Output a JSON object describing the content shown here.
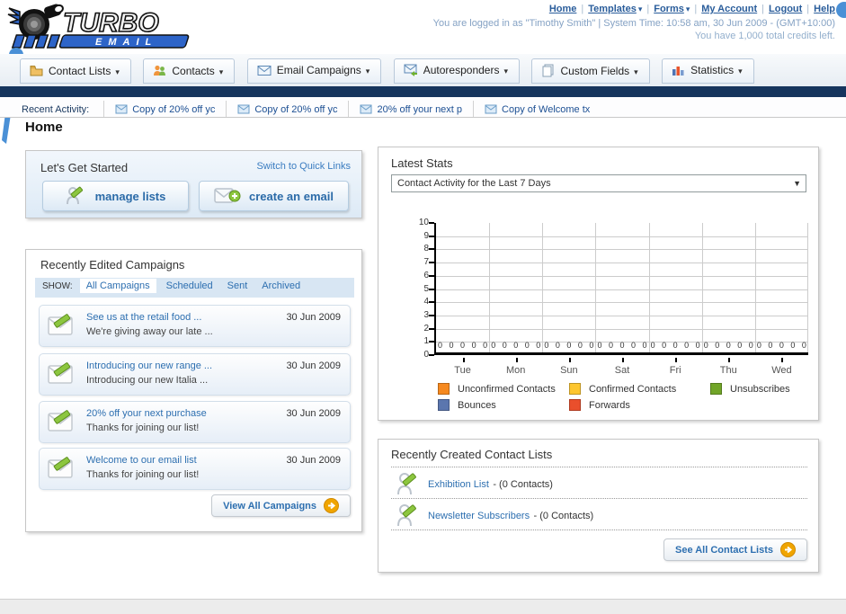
{
  "ui": {
    "separator": "|",
    "dropdown_arrow": "▾",
    "select_arrow": "▼"
  },
  "header": {
    "logo_title": "TURBO",
    "logo_subtitle": "E M A I L",
    "nav_links": [
      {
        "label": "Home",
        "has_dropdown": false
      },
      {
        "label": "Templates",
        "has_dropdown": true
      },
      {
        "label": "Forms",
        "has_dropdown": true
      },
      {
        "label": "My Account",
        "has_dropdown": false
      },
      {
        "label": "Logout",
        "has_dropdown": false
      },
      {
        "label": "Help",
        "has_dropdown": false
      }
    ],
    "login_status": "You are logged in as \"Timothy Smith\" | System Time: 10:58 am, 30 Jun 2009 - (GMT+10:00)",
    "credits": "You have 1,000 total credits left."
  },
  "tabs": [
    {
      "label": "Contact Lists"
    },
    {
      "label": "Contacts"
    },
    {
      "label": "Email Campaigns"
    },
    {
      "label": "Autoresponders"
    },
    {
      "label": "Custom Fields"
    },
    {
      "label": "Statistics"
    }
  ],
  "recent_activity": {
    "label": "Recent Activity:",
    "items": [
      "Copy of 20% off yc",
      "Copy of 20% off yc",
      "20% off your next p",
      "Copy of Welcome tx"
    ]
  },
  "page_title": "Home",
  "get_started": {
    "title": "Let's Get Started",
    "switch_link": "Switch to Quick Links",
    "buttons": [
      {
        "label": "manage lists"
      },
      {
        "label": "create an email"
      }
    ]
  },
  "campaigns": {
    "title": "Recently Edited Campaigns",
    "show_label": "SHOW:",
    "filters": [
      "All Campaigns",
      "Scheduled",
      "Sent",
      "Archived"
    ],
    "active_filter": "All Campaigns",
    "items": [
      {
        "title": "See us at the retail food ...",
        "subtitle": "We're giving away our late ...",
        "date": "30 Jun 2009"
      },
      {
        "title": "Introducing our new range ...",
        "subtitle": "Introducing our new Italia ...",
        "date": "30 Jun 2009"
      },
      {
        "title": "20% off your next purchase",
        "subtitle": "Thanks for joining our list!",
        "date": "30 Jun 2009"
      },
      {
        "title": "Welcome to our email list",
        "subtitle": "Thanks for joining our list!",
        "date": "30 Jun 2009"
      }
    ],
    "view_all_label": "View All Campaigns"
  },
  "latest_stats": {
    "title": "Latest Stats",
    "dropdown_value": "Contact Activity for the Last 7 Days",
    "chart_data": {
      "type": "bar",
      "title": "Contact Activity for the Last 7 Days",
      "categories": [
        "Tue",
        "Mon",
        "Sun",
        "Sat",
        "Fri",
        "Thu",
        "Wed"
      ],
      "ylim": [
        0,
        10
      ],
      "yticks": [
        0,
        1,
        2,
        3,
        4,
        5,
        6,
        7,
        8,
        9,
        10
      ],
      "grid": true,
      "legend_position": "bottom",
      "series": [
        {
          "name": "Unconfirmed Contacts",
          "color": "#f6891f",
          "values": [
            0,
            0,
            0,
            0,
            0,
            0,
            0
          ]
        },
        {
          "name": "Confirmed Contacts",
          "color": "#fdc62f",
          "values": [
            0,
            0,
            0,
            0,
            0,
            0,
            0
          ]
        },
        {
          "name": "Unsubscribes",
          "color": "#71a528",
          "values": [
            0,
            0,
            0,
            0,
            0,
            0,
            0
          ]
        },
        {
          "name": "Bounces",
          "color": "#5b76ae",
          "values": [
            0,
            0,
            0,
            0,
            0,
            0,
            0
          ]
        },
        {
          "name": "Forwards",
          "color": "#e94f2c",
          "values": [
            0,
            0,
            0,
            0,
            0,
            0,
            0
          ]
        }
      ]
    }
  },
  "contact_lists": {
    "title": "Recently Created Contact Lists",
    "items": [
      {
        "name": "Exhibition List",
        "detail": "- (0 Contacts)"
      },
      {
        "name": "Newsletter Subscribers",
        "detail": "- (0 Contacts)"
      }
    ],
    "see_all_label": "See All Contact Lists"
  }
}
